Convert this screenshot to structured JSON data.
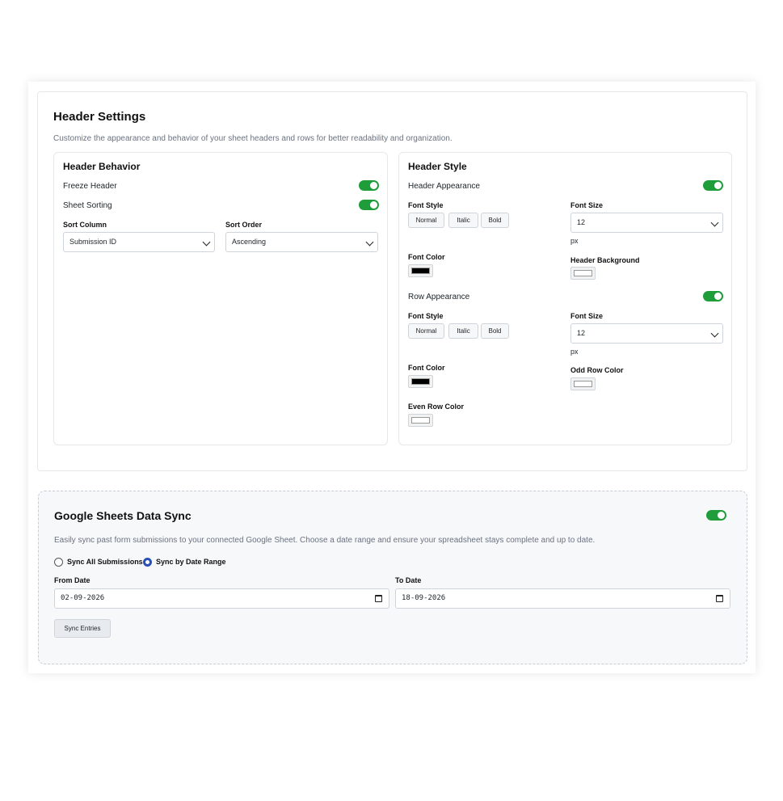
{
  "header_settings": {
    "title": "Header Settings",
    "description": "Customize the appearance and behavior of your sheet headers and rows for better readability and organization.",
    "behavior": {
      "title": "Header Behavior",
      "freeze_header": "Freeze Header",
      "sheet_sorting": "Sheet Sorting",
      "sort_column_label": "Sort Column",
      "sort_column_value": "Submission ID",
      "sort_order_label": "Sort Order",
      "sort_order_value": "Ascending"
    },
    "style": {
      "title": "Header Style",
      "header_appearance": "Header Appearance",
      "font_style_label": "Font Style",
      "btn_normal": "Normal",
      "btn_italic": "Italic",
      "btn_bold": "Bold",
      "font_size_label": "Font Size",
      "header_font_size": "12",
      "px": "px",
      "font_color_label": "Font Color",
      "header_background_label": "Header Background",
      "row_appearance": "Row Appearance",
      "row_font_size": "12",
      "odd_row_color_label": "Odd Row Color",
      "even_row_color_label": "Even Row Color"
    },
    "colors": {
      "header_font": "#000000",
      "header_background": "#ffffff",
      "row_font": "#000000",
      "odd_row": "#ffffff",
      "even_row": "#ffffff",
      "toggle_on": "#1f9d3a"
    }
  },
  "sync": {
    "title": "Google Sheets Data Sync",
    "description": "Easily sync past form submissions to your connected Google Sheet. Choose a date range and ensure your spreadsheet stays complete and up to date.",
    "radio_all": "Sync All Submissions",
    "radio_range": "Sync by Date Range",
    "from_date_label": "From Date",
    "from_date_value": "02-09-2026",
    "to_date_label": "To Date",
    "to_date_value": "18-09-2026",
    "button": "Sync Entries",
    "radio_accent": "#2a4fb7"
  }
}
